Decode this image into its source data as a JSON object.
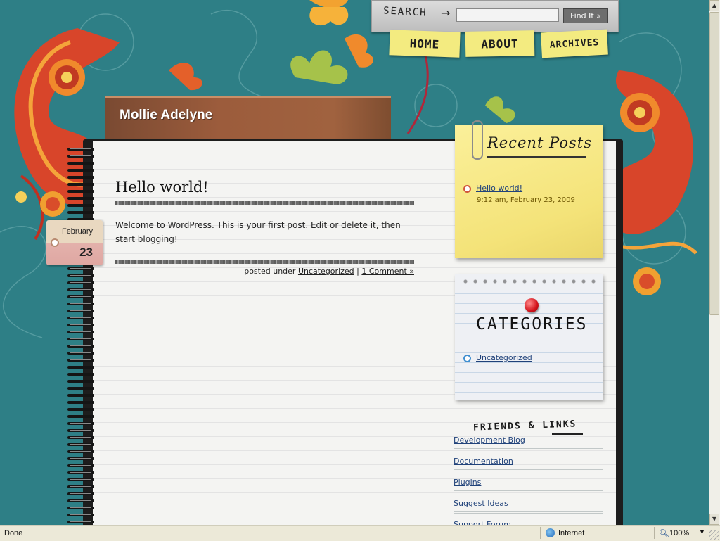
{
  "header": {
    "search_label": "SEARCH",
    "search_placeholder": "",
    "search_button": "Find It »"
  },
  "nav": [
    {
      "label": "HOME"
    },
    {
      "label": "ABOUT"
    },
    {
      "label": "ARCHIVES"
    }
  ],
  "blog": {
    "title": "Mollie Adelyne"
  },
  "post": {
    "date_month": "February",
    "date_day": "23",
    "title": "Hello world!",
    "body": "Welcome to WordPress. This is your first post. Edit or delete it, then start blogging!",
    "meta_prefix": "posted under",
    "category": "Uncategorized",
    "separator": "|",
    "comments": "1 Comment »"
  },
  "sidebar": {
    "recent": {
      "heading": "Recent Posts",
      "items": [
        {
          "title": "Hello world!",
          "date": "9:12 am, February 23, 2009"
        }
      ]
    },
    "categories": {
      "heading": "CATEGORIES",
      "items": [
        {
          "label": "Uncategorized"
        }
      ]
    },
    "links": {
      "heading": "FRIENDS & LINKS",
      "items": [
        {
          "label": "Development Blog"
        },
        {
          "label": "Documentation"
        },
        {
          "label": "Plugins"
        },
        {
          "label": "Suggest Ideas"
        },
        {
          "label": "Support Forum"
        }
      ]
    }
  },
  "statusbar": {
    "status": "Done",
    "zone": "Internet",
    "zoom": "100%"
  },
  "colors": {
    "teal_background": "#2e7f86",
    "sticky_yellow": "#f4e379",
    "title_tab_brown": "#9c5c3c",
    "link_blue": "#20427a"
  }
}
